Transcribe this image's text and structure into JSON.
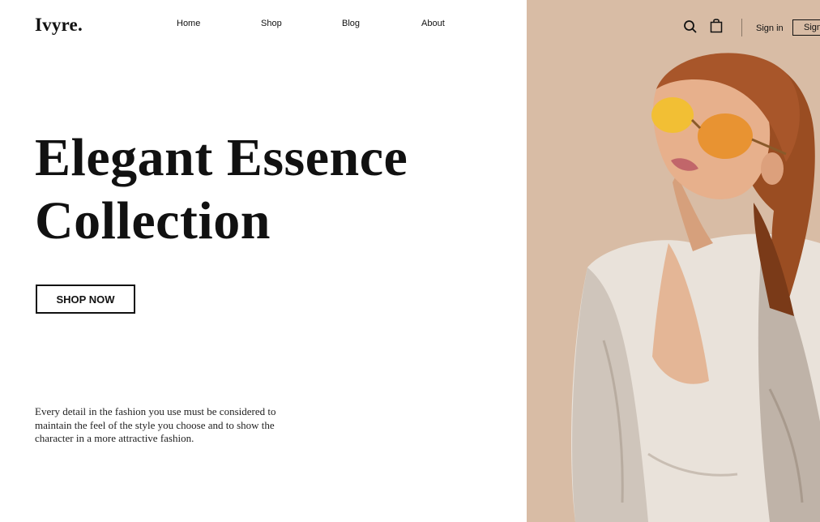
{
  "brand": {
    "logo": "Ivyre."
  },
  "nav": {
    "home": "Home",
    "shop": "Shop",
    "blog": "Blog",
    "about": "About"
  },
  "hero": {
    "title_line1": "Elegant Essence",
    "title_line2": "Collection",
    "cta_label": "SHOP NOW",
    "description": "Every detail in the fashion you use must be considered to maintain the feel of the style you choose and to show the character in a more attractive fashion."
  },
  "header_actions": {
    "search_icon": "search-icon",
    "cart_icon": "shopping-bag-icon",
    "signin_label": "Sign in",
    "signup_label": "Sign up"
  },
  "colors": {
    "panel_bg": "#d8bca5",
    "text": "#111111"
  }
}
